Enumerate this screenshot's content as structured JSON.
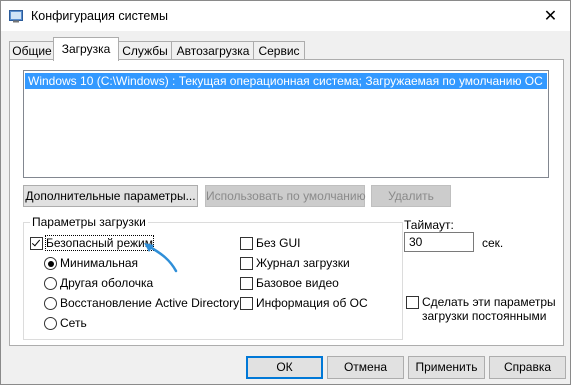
{
  "window": {
    "title": "Конфигурация системы",
    "close_icon": "✕"
  },
  "tabs": [
    {
      "label": "Общие"
    },
    {
      "label": "Загрузка",
      "active": true
    },
    {
      "label": "Службы"
    },
    {
      "label": "Автозагрузка"
    },
    {
      "label": "Сервис"
    }
  ],
  "os_list": {
    "selected_entry": "Windows 10 (C:\\Windows) : Текущая операционная система; Загружаемая по умолчанию ОС"
  },
  "list_buttons": {
    "advanced": "Дополнительные параметры...",
    "set_default": "Использовать по умолчанию",
    "delete": "Удалить"
  },
  "boot_options": {
    "group_label": "Параметры загрузки",
    "safe_boot": {
      "label": "Безопасный режим",
      "checked": true
    },
    "radios": [
      {
        "label": "Минимальная",
        "checked": true
      },
      {
        "label": "Другая оболочка",
        "checked": false
      },
      {
        "label": "Восстановление Active Directory",
        "checked": false
      },
      {
        "label": "Сеть",
        "checked": false
      }
    ],
    "right_checks": [
      {
        "label": "Без GUI",
        "checked": false
      },
      {
        "label": "Журнал загрузки",
        "checked": false
      },
      {
        "label": "Базовое видео",
        "checked": false
      },
      {
        "label": "Информация  об ОС",
        "checked": false
      }
    ]
  },
  "timeout": {
    "label": "Таймаут:",
    "value": "30",
    "unit": "сек."
  },
  "persistent": {
    "label_line1": "Сделать эти параметры",
    "label_line2": "загрузки постоянными",
    "checked": false
  },
  "footer": {
    "ok": "ОК",
    "cancel": "Отмена",
    "apply": "Применить",
    "help": "Справка"
  },
  "colors": {
    "selection": "#3399ff",
    "annotation_arrow": "#2f8fd8"
  }
}
